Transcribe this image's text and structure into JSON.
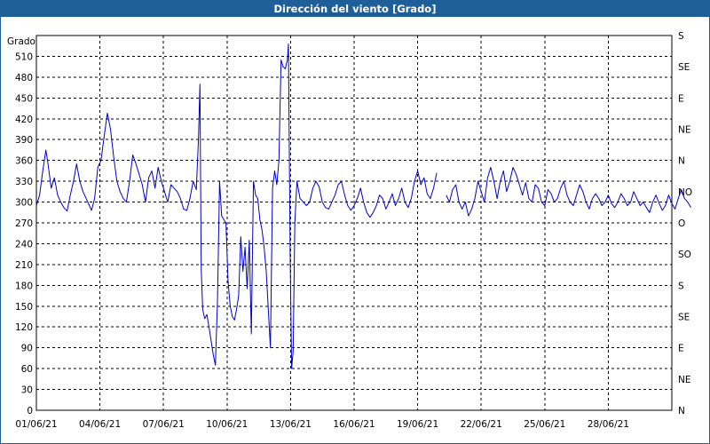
{
  "window": {
    "title": "Dirección del viento [Grado]"
  },
  "chart_data": {
    "type": "line",
    "title": "Dirección del viento [Grado]",
    "ylabel": "Grado",
    "ylim": [
      0,
      540
    ],
    "xlim": [
      "01/06/21 00:00",
      "01/07/21 00:00"
    ],
    "grid": true,
    "y_ticks": [
      0,
      30,
      60,
      90,
      120,
      150,
      180,
      210,
      240,
      270,
      300,
      330,
      360,
      390,
      420,
      450,
      480,
      510
    ],
    "x_ticks": [
      "01/06/21",
      "04/06/21",
      "07/06/21",
      "10/06/21",
      "13/06/21",
      "16/06/21",
      "19/06/21",
      "22/06/21",
      "25/06/21",
      "28/06/21"
    ],
    "right_axis_labels": [
      {
        "value": 0,
        "label": "N"
      },
      {
        "value": 45,
        "label": "NE"
      },
      {
        "value": 90,
        "label": "E"
      },
      {
        "value": 135,
        "label": "SE"
      },
      {
        "value": 180,
        "label": "S"
      },
      {
        "value": 225,
        "label": "SO"
      },
      {
        "value": 270,
        "label": "O"
      },
      {
        "value": 315,
        "label": "NO"
      },
      {
        "value": 360,
        "label": "N"
      },
      {
        "value": 405,
        "label": "NE"
      },
      {
        "value": 450,
        "label": "E"
      },
      {
        "value": 495,
        "label": "SE"
      },
      {
        "value": 540,
        "label": "S"
      }
    ],
    "series": [
      {
        "color": "#0000cc",
        "points": [
          [
            0.0,
            295
          ],
          [
            0.15,
            310
          ],
          [
            0.3,
            345
          ],
          [
            0.45,
            375
          ],
          [
            0.55,
            355
          ],
          [
            0.7,
            320
          ],
          [
            0.85,
            335
          ],
          [
            1.0,
            310
          ],
          [
            1.15,
            300
          ],
          [
            1.3,
            292
          ],
          [
            1.45,
            287
          ],
          [
            1.6,
            310
          ],
          [
            1.75,
            330
          ],
          [
            1.9,
            355
          ],
          [
            2.05,
            330
          ],
          [
            2.2,
            315
          ],
          [
            2.35,
            305
          ],
          [
            2.5,
            295
          ],
          [
            2.6,
            288
          ],
          [
            2.75,
            305
          ],
          [
            2.9,
            350
          ],
          [
            3.05,
            360
          ],
          [
            3.2,
            395
          ],
          [
            3.35,
            428
          ],
          [
            3.5,
            405
          ],
          [
            3.65,
            365
          ],
          [
            3.8,
            330
          ],
          [
            3.95,
            315
          ],
          [
            4.1,
            305
          ],
          [
            4.25,
            300
          ],
          [
            4.4,
            330
          ],
          [
            4.55,
            368
          ],
          [
            4.7,
            355
          ],
          [
            4.85,
            340
          ],
          [
            5.0,
            325
          ],
          [
            5.15,
            300
          ],
          [
            5.3,
            335
          ],
          [
            5.45,
            345
          ],
          [
            5.6,
            320
          ],
          [
            5.75,
            350
          ],
          [
            5.9,
            330
          ],
          [
            6.05,
            315
          ],
          [
            6.2,
            300
          ],
          [
            6.35,
            325
          ],
          [
            6.5,
            320
          ],
          [
            6.65,
            315
          ],
          [
            6.8,
            305
          ],
          [
            6.95,
            290
          ],
          [
            7.1,
            288
          ],
          [
            7.25,
            305
          ],
          [
            7.4,
            330
          ],
          [
            7.55,
            318
          ],
          [
            7.65,
            390
          ],
          [
            7.72,
            470
          ],
          [
            7.78,
            205
          ],
          [
            7.85,
            145
          ],
          [
            7.95,
            132
          ],
          [
            8.05,
            138
          ],
          [
            8.15,
            120
          ],
          [
            8.25,
            100
          ],
          [
            8.35,
            80
          ],
          [
            8.45,
            65
          ],
          [
            8.55,
            160
          ],
          [
            8.65,
            330
          ],
          [
            8.75,
            280
          ],
          [
            8.85,
            275
          ],
          [
            8.95,
            270
          ],
          [
            9.05,
            185
          ],
          [
            9.15,
            150
          ],
          [
            9.25,
            135
          ],
          [
            9.35,
            130
          ],
          [
            9.45,
            145
          ],
          [
            9.55,
            165
          ],
          [
            9.65,
            250
          ],
          [
            9.75,
            200
          ],
          [
            9.85,
            235
          ],
          [
            9.95,
            175
          ],
          [
            10.05,
            245
          ],
          [
            10.15,
            110
          ],
          [
            10.25,
            330
          ],
          [
            10.35,
            310
          ],
          [
            10.45,
            305
          ],
          [
            10.55,
            275
          ],
          [
            10.65,
            260
          ],
          [
            10.75,
            235
          ],
          [
            10.85,
            200
          ],
          [
            10.95,
            145
          ],
          [
            11.05,
            90
          ],
          [
            11.15,
            320
          ],
          [
            11.25,
            345
          ],
          [
            11.35,
            325
          ],
          [
            11.45,
            360
          ],
          [
            11.55,
            505
          ],
          [
            11.65,
            495
          ],
          [
            11.75,
            492
          ],
          [
            11.85,
            505
          ],
          [
            11.9,
            528
          ],
          [
            11.98,
            230
          ],
          [
            12.05,
            60
          ],
          [
            12.12,
            85
          ],
          [
            12.2,
            270
          ],
          [
            12.3,
            330
          ],
          [
            12.45,
            305
          ],
          [
            12.6,
            300
          ],
          [
            12.75,
            295
          ],
          [
            12.9,
            300
          ],
          [
            13.05,
            320
          ],
          [
            13.2,
            330
          ],
          [
            13.35,
            322
          ],
          [
            13.5,
            300
          ],
          [
            13.65,
            292
          ],
          [
            13.8,
            290
          ],
          [
            13.95,
            300
          ],
          [
            14.1,
            310
          ],
          [
            14.25,
            325
          ],
          [
            14.4,
            330
          ],
          [
            14.55,
            310
          ],
          [
            14.7,
            295
          ],
          [
            14.85,
            288
          ],
          [
            15.0,
            295
          ],
          [
            15.15,
            305
          ],
          [
            15.3,
            320
          ],
          [
            15.45,
            300
          ],
          [
            15.6,
            285
          ],
          [
            15.75,
            278
          ],
          [
            15.9,
            285
          ],
          [
            16.05,
            295
          ],
          [
            16.2,
            310
          ],
          [
            16.35,
            305
          ],
          [
            16.5,
            290
          ],
          [
            16.65,
            300
          ],
          [
            16.8,
            312
          ],
          [
            16.95,
            295
          ],
          [
            17.1,
            305
          ],
          [
            17.25,
            320
          ],
          [
            17.4,
            300
          ],
          [
            17.55,
            292
          ],
          [
            17.7,
            305
          ],
          [
            17.85,
            330
          ],
          [
            18.0,
            345
          ],
          [
            18.15,
            325
          ],
          [
            18.3,
            335
          ],
          [
            18.45,
            312
          ],
          [
            18.6,
            305
          ],
          [
            18.75,
            320
          ],
          [
            18.9,
            342
          ],
          null,
          [
            19.35,
            310
          ],
          [
            19.5,
            300
          ],
          [
            19.65,
            318
          ],
          [
            19.8,
            325
          ],
          [
            19.95,
            300
          ],
          [
            20.1,
            290
          ],
          [
            20.25,
            300
          ],
          [
            20.4,
            280
          ],
          [
            20.55,
            290
          ],
          [
            20.7,
            305
          ],
          [
            20.85,
            330
          ],
          [
            21.0,
            315
          ],
          [
            21.15,
            300
          ],
          [
            21.3,
            335
          ],
          [
            21.45,
            350
          ],
          [
            21.6,
            330
          ],
          [
            21.75,
            305
          ],
          [
            21.9,
            330
          ],
          [
            22.05,
            345
          ],
          [
            22.2,
            315
          ],
          [
            22.35,
            330
          ],
          [
            22.5,
            350
          ],
          [
            22.65,
            340
          ],
          [
            22.8,
            325
          ],
          [
            22.95,
            310
          ],
          [
            23.1,
            328
          ],
          [
            23.25,
            305
          ],
          [
            23.4,
            300
          ],
          [
            23.55,
            325
          ],
          [
            23.7,
            320
          ],
          [
            23.85,
            300
          ],
          [
            24.0,
            295
          ],
          [
            24.15,
            318
          ],
          [
            24.3,
            312
          ],
          [
            24.45,
            300
          ],
          [
            24.6,
            305
          ],
          [
            24.75,
            320
          ],
          [
            24.9,
            330
          ],
          [
            25.05,
            310
          ],
          [
            25.2,
            300
          ],
          [
            25.35,
            295
          ],
          [
            25.5,
            310
          ],
          [
            25.65,
            325
          ],
          [
            25.8,
            315
          ],
          [
            25.95,
            300
          ],
          [
            26.1,
            290
          ],
          [
            26.25,
            305
          ],
          [
            26.4,
            312
          ],
          [
            26.55,
            305
          ],
          [
            26.7,
            295
          ],
          [
            26.85,
            300
          ],
          [
            27.0,
            310
          ],
          [
            27.15,
            298
          ],
          [
            27.3,
            292
          ],
          [
            27.45,
            300
          ],
          [
            27.6,
            312
          ],
          [
            27.75,
            305
          ],
          [
            27.9,
            295
          ],
          [
            28.05,
            300
          ],
          [
            28.2,
            315
          ],
          [
            28.35,
            305
          ],
          [
            28.5,
            295
          ],
          [
            28.65,
            300
          ],
          [
            28.8,
            292
          ],
          [
            28.95,
            285
          ],
          [
            29.1,
            300
          ],
          [
            29.25,
            310
          ],
          [
            29.4,
            298
          ],
          [
            29.55,
            288
          ],
          [
            29.7,
            295
          ],
          [
            29.85,
            310
          ],
          [
            30.0,
            298
          ],
          [
            30.15,
            290
          ],
          [
            30.3,
            305
          ],
          [
            30.45,
            318
          ],
          [
            30.6,
            305
          ],
          [
            30.75,
            300
          ],
          [
            30.9,
            292
          ]
        ]
      }
    ]
  }
}
